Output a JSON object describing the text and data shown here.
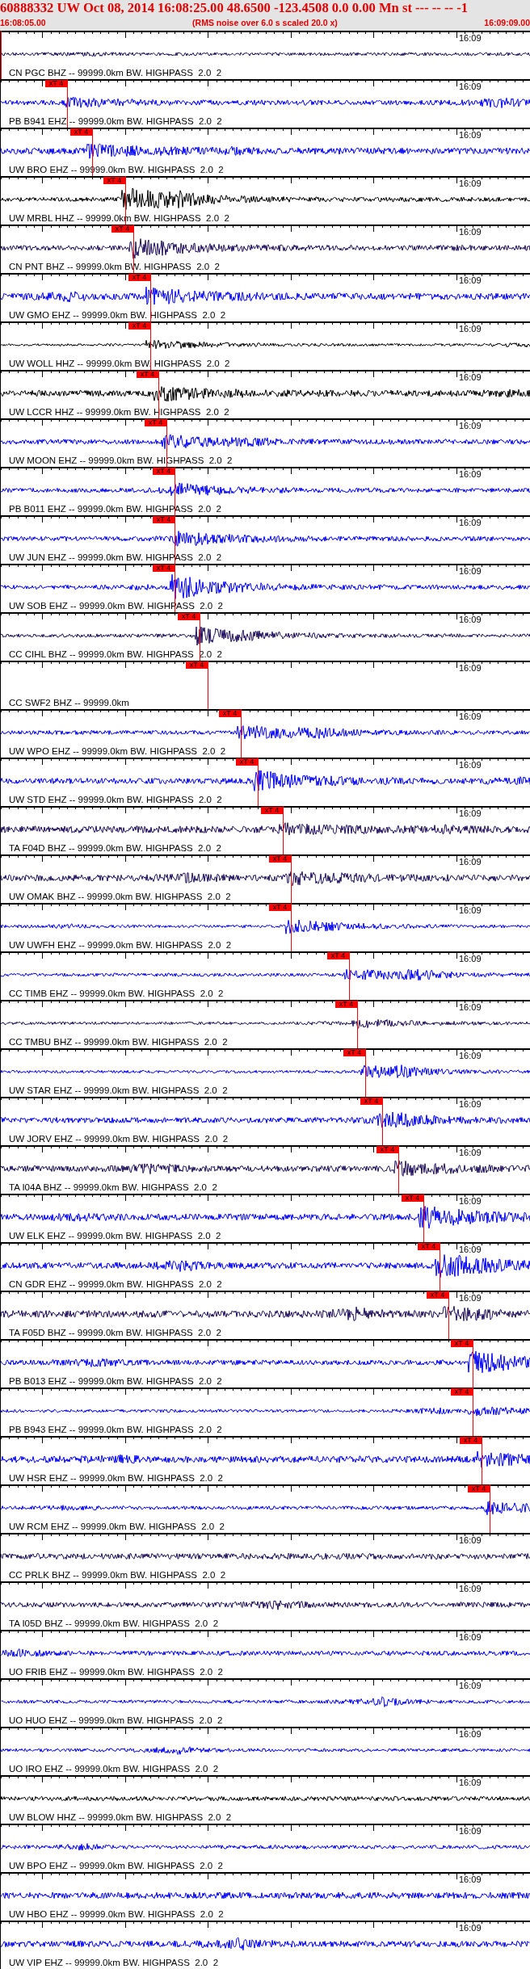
{
  "header": {
    "title": "60888332 UW Oct 08, 2014 16:08:25.00   48.6500 -123.4508  0.0 0.00 Mn st --- -- --  -1",
    "start_time": "16:08:05.00",
    "note": "(RMS noise over 6.0 s scaled 20.0 x)",
    "end_time": "16:09:09.00"
  },
  "traces": [
    {
      "label": "CN PGC BHZ -- 99999.0km BW. HIGHPASS  2.0  2",
      "time_mark": "16:09",
      "color": "#1c0c5c",
      "pick": {
        "level": 0
      }
    },
    {
      "label": "PB B941 EHZ -- 99999.0km BW. HIGHPASS  2.0  2",
      "time_mark": "16:09",
      "color": "#0000ff",
      "pick": {
        "label": "xT 4",
        "level": 0.125
      }
    },
    {
      "label": "UW BRO EHZ -- 99999.0km BW. HIGHPASS  2.0  2",
      "time_mark": "16:09",
      "color": "#0000ff",
      "pick": {
        "label": "xT 4",
        "level": 0.172
      }
    },
    {
      "label": "UW MRBL HHZ -- 99999.0km BW. HIGHPASS  2.0  2",
      "time_mark": "16:09",
      "color": "#000000",
      "pick": {
        "label": "xT 4",
        "level": 0.235
      }
    },
    {
      "label": "CN PNT BHZ -- 99999.0km BW. HIGHPASS  2.0  2",
      "time_mark": "16:09",
      "color": "#1c0c5c",
      "pick": {
        "label": "xT 4",
        "level": 0.25
      }
    },
    {
      "label": "UW GMO EHZ -- 99999.0km BW. HIGHPASS  2.0  2",
      "time_mark": "16:09",
      "color": "#0000ff",
      "pick": {
        "label": "xT 4",
        "level": 0.282
      }
    },
    {
      "label": "UW WOLL HHZ -- 99999.0km BW. HIGHPASS  2.0  2",
      "time_mark": "16:09",
      "color": "#000000",
      "pick": {
        "label": "xT 4",
        "level": 0.282
      }
    },
    {
      "label": "UW LCCR HHZ -- 99999.0km BW. HIGHPASS  2.0  2",
      "time_mark": "16:09",
      "color": "#000000",
      "pick": {
        "label": "xT 4",
        "level": 0.297
      }
    },
    {
      "label": "UW MOON EHZ -- 99999.0km BW. HIGHPASS  2.0  2",
      "time_mark": "16:09",
      "color": "#0000ff",
      "pick": {
        "label": "xT 4",
        "level": 0.313
      }
    },
    {
      "label": "PB B011 EHZ -- 99999.0km BW. HIGHPASS  2.0  2",
      "time_mark": "16:09",
      "color": "#0000ff",
      "pick": {
        "label": "xT 4",
        "level": 0.328
      }
    },
    {
      "label": "UW JUN EHZ -- 99999.0km BW. HIGHPASS  2.0  2",
      "time_mark": "16:09",
      "color": "#0000ff",
      "pick": {
        "label": "xT 4",
        "level": 0.328
      }
    },
    {
      "label": "UW SOB EHZ -- 99999.0km BW. HIGHPASS  2.0  2",
      "time_mark": "16:09",
      "color": "#0000ff",
      "pick": {
        "label": "xT 4",
        "level": 0.328
      }
    },
    {
      "label": "CC CIHL BHZ -- 99999.0km BW. HIGHPASS  2.0  2",
      "time_mark": "16:09",
      "color": "#1c0c5c",
      "pick": {
        "label": "xT 4",
        "level": 0.375
      }
    },
    {
      "label": "CC SWF2 BHZ -- 99999.0km",
      "time_mark": "16:09",
      "pick": {
        "label": "xT 4",
        "level": 0.39
      }
    },
    {
      "label": "UW WPO EHZ -- 99999.0km BW. HIGHPASS  2.0  2",
      "time_mark": "16:09",
      "color": "#0000ff",
      "pick": {
        "label": "xT 4",
        "level": 0.453
      }
    },
    {
      "label": "UW STD EHZ -- 99999.0km BW. HIGHPASS  2.0  2",
      "time_mark": "16:09",
      "color": "#0000ff",
      "pick": {
        "label": "xT 4",
        "level": 0.485
      }
    },
    {
      "label": "TA F04D BHZ -- 99999.0km BW. HIGHPASS  2.0  2",
      "time_mark": "16:09",
      "color": "#1c0c5c",
      "pick": {
        "label": "xT 4",
        "level": 0.532
      }
    },
    {
      "label": "UW OMAK BHZ -- 99999.0km BW. HIGHPASS  2.0  2",
      "time_mark": "16:09",
      "color": "#1c0c5c",
      "pick": {
        "label": "xT 4",
        "level": 0.547
      }
    },
    {
      "label": "UW UWFH EHZ -- 99999.0km BW. HIGHPASS  2.0  2",
      "time_mark": "16:09",
      "color": "#0000ff",
      "pick": {
        "label": "xT 4",
        "level": 0.547
      }
    },
    {
      "label": "CC TIMB EHZ -- 99999.0km BW. HIGHPASS  2.0  2",
      "time_mark": "16:09",
      "color": "#0000ff",
      "pick": {
        "label": "xT 4",
        "level": 0.657
      }
    },
    {
      "label": "CC TMBU BHZ -- 99999.0km BW. HIGHPASS  2.0  2",
      "time_mark": "16:09",
      "color": "#1c0c5c",
      "pick": {
        "label": "xT 4",
        "level": 0.672
      }
    },
    {
      "label": "UW STAR EHZ -- 99999.0km BW. HIGHPASS  2.0  2",
      "time_mark": "16:09",
      "color": "#0000ff",
      "pick": {
        "label": "xT 4",
        "level": 0.688
      }
    },
    {
      "label": "UW JORV EHZ -- 99999.0km BW. HIGHPASS  2.0  2",
      "time_mark": "16:09",
      "color": "#0000ff",
      "pick": {
        "label": "xT 4",
        "level": 0.719
      }
    },
    {
      "label": "TA I04A BHZ -- 99999.0km BW. HIGHPASS  2.0  2",
      "time_mark": "16:09",
      "color": "#1c0c5c",
      "pick": {
        "label": "xT 4",
        "level": 0.75
      }
    },
    {
      "label": "UW ELK EHZ -- 99999.0km BW. HIGHPASS  2.0  2",
      "time_mark": "16:09",
      "color": "#0000ff",
      "pick": {
        "label": "xT 4",
        "level": 0.797
      }
    },
    {
      "label": "CN GDR EHZ -- 99999.0km BW. HIGHPASS  2.0  2",
      "time_mark": "16:09",
      "color": "#0000ff",
      "pick": {
        "label": "xT 4",
        "level": 0.828
      }
    },
    {
      "label": "TA F05D BHZ -- 99999.0km BW. HIGHPASS  2.0  2",
      "time_mark": "16:09",
      "color": "#1c0c5c",
      "pick": {
        "label": "xT 4",
        "level": 0.844
      }
    },
    {
      "label": "PB B013 EHZ -- 99999.0km BW. HIGHPASS  2.0  2",
      "color": "#0000ff",
      "pick": {
        "label": "xT 4",
        "level": 0.89
      }
    },
    {
      "label": "PB B943 EHZ -- 99999.0km BW. HIGHPASS  2.0  2",
      "color": "#0000ff",
      "pick": {
        "label": "xT 4",
        "level": 0.89
      }
    },
    {
      "label": "UW HSR EHZ -- 99999.0km BW. HIGHPASS  2.0  2",
      "color": "#0000ff",
      "pick": {
        "label": "xT 4",
        "level": 0.907
      }
    },
    {
      "label": "UW RCM EHZ -- 99999.0km BW. HIGHPASS  2.0  2",
      "color": "#0000ff",
      "pick": {
        "label": "xT 4",
        "level": 0.922
      }
    },
    {
      "label": "CC PRLK BHZ -- 99999.0km BW. HIGHPASS  2.0  2",
      "time_mark": "16:09",
      "color": "#1c0c5c"
    },
    {
      "label": "TA I05D BHZ -- 99999.0km BW. HIGHPASS  2.0  2",
      "time_mark": "16:09",
      "color": "#1c0c5c"
    },
    {
      "label": "UO FRIB EHZ -- 99999.0km BW. HIGHPASS  2.0  2",
      "time_mark": "16:09",
      "color": "#0000ff"
    },
    {
      "label": "UO HUO EHZ -- 99999.0km BW. HIGHPASS  2.0  2",
      "time_mark": "16:09",
      "color": "#0000ff"
    },
    {
      "label": "UO IRO EHZ -- 99999.0km BW. HIGHPASS  2.0  2",
      "time_mark": "16:09",
      "color": "#0000ff"
    },
    {
      "label": "UW BLOW HHZ -- 99999.0km BW. HIGHPASS  2.0  2",
      "time_mark": "16:09",
      "color": "#000000"
    },
    {
      "label": "UW BPO EHZ -- 99999.0km BW. HIGHPASS  2.0  2",
      "time_mark": "16:09",
      "color": "#0000ff"
    },
    {
      "label": "UW HBO EHZ -- 99999.0km BW. HIGHPASS  2.0  2",
      "time_mark": "16:09",
      "color": "#0000ff"
    },
    {
      "label": "UW VIP EHZ -- 99999.0km BW. HIGHPASS  2.0  2",
      "time_mark": "16:09",
      "color": "#0000ff"
    }
  ]
}
